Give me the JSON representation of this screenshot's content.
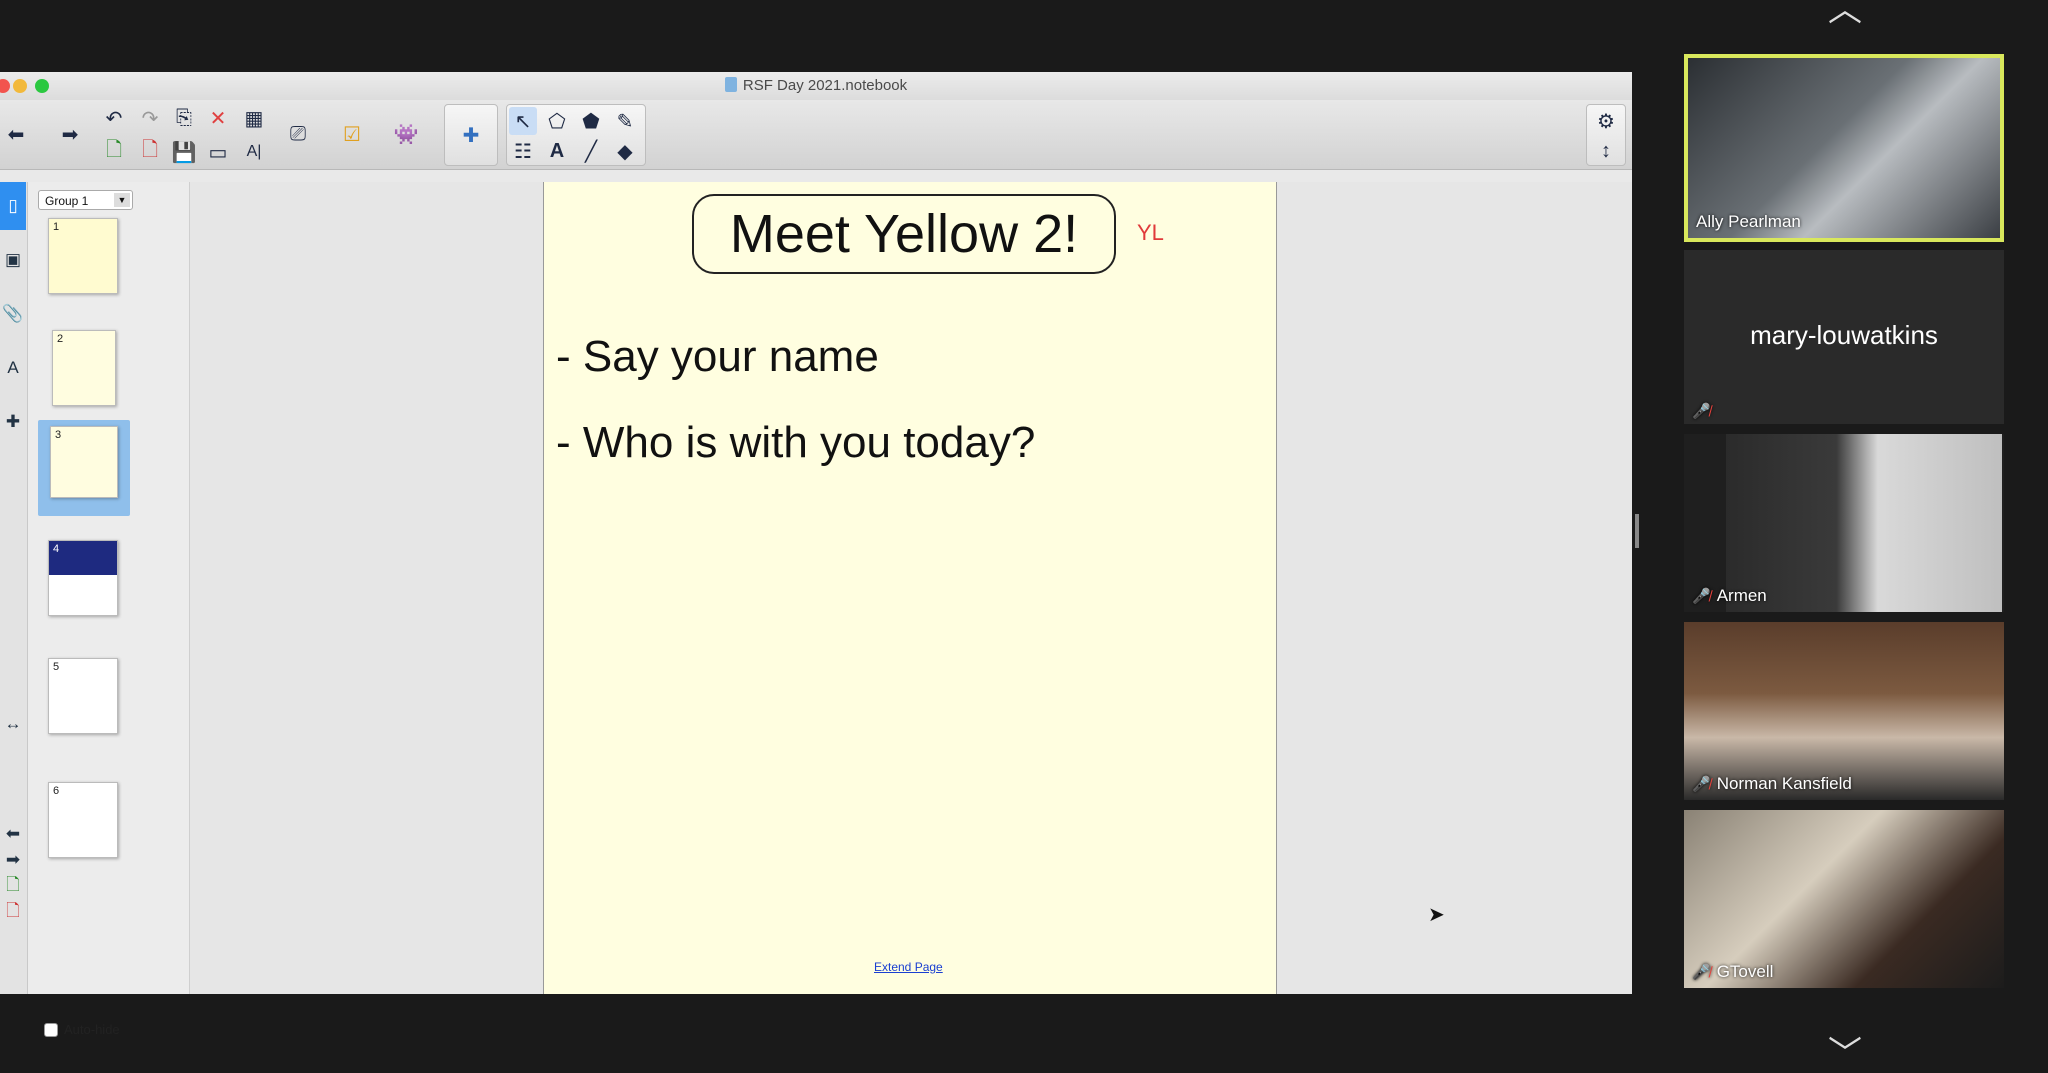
{
  "window": {
    "title": "RSF Day 2021.notebook",
    "traffic_colors": [
      "#f2544e",
      "#f2b93b",
      "#2bc840"
    ]
  },
  "toolbar": {
    "icons": [
      "back-arrow",
      "forward-arrow",
      "undo",
      "redo",
      "paste",
      "delete",
      "table",
      "new-page",
      "delete-page",
      "save",
      "screen-shade",
      "text-tools",
      "screen-capture",
      "activity-builder",
      "addons",
      "puzzle",
      "select",
      "shapes",
      "fill",
      "pen",
      "properties",
      "text",
      "line",
      "eraser",
      "settings",
      "move-toolbar"
    ]
  },
  "sidebar": {
    "group_label": "Group 1",
    "pages": [
      {
        "number": "1",
        "style": "colorful"
      },
      {
        "number": "2",
        "style": "text"
      },
      {
        "number": "3",
        "style": "selected"
      },
      {
        "number": "4",
        "style": "image"
      },
      {
        "number": "5",
        "style": "blank"
      },
      {
        "number": "6",
        "style": "text"
      }
    ],
    "autohide_label": "Auto-hide"
  },
  "page": {
    "title": "Meet Yellow 2!",
    "tag": "YL",
    "bullets": [
      "- Say your name",
      "- Who is with you today?"
    ],
    "extend_link": "Extend Page"
  },
  "participants": [
    {
      "name": "Ally Pearlman",
      "muted": false,
      "active_speaker": true,
      "has_video": true
    },
    {
      "name": "mary-louwatkins",
      "muted": true,
      "active_speaker": false,
      "has_video": false
    },
    {
      "name": "Armen",
      "muted": true,
      "active_speaker": false,
      "has_video": true
    },
    {
      "name": "Norman Kansfield",
      "muted": true,
      "active_speaker": false,
      "has_video": true
    },
    {
      "name": "GTovell",
      "muted": true,
      "active_speaker": false,
      "has_video": true
    }
  ],
  "colors": {
    "page_bg": "#fffee0",
    "active_speaker_border": "#d9e85c",
    "mute": "#e8413c",
    "link": "#1a3fd1"
  }
}
